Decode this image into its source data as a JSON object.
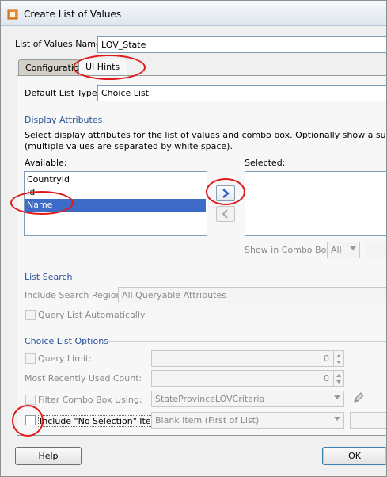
{
  "window": {
    "title": "Create List of Values"
  },
  "lov_name": {
    "label": "List of Values Name:",
    "value": "LOV_State"
  },
  "tabs": [
    {
      "label": "Configuration"
    },
    {
      "label": "UI Hints"
    }
  ],
  "default_list_type": {
    "label": "Default List Type:",
    "value": "Choice List"
  },
  "display_attributes": {
    "title": "Display Attributes",
    "description_line1": "Select display attributes for the list of values and combo box. Optionally show a subset in the",
    "description_line2": "(multiple values are separated by white space).",
    "available_label": "Available:",
    "selected_label": "Selected:",
    "available_items": [
      "CountryId",
      "Id",
      "Name"
    ],
    "show_in_combo_label": "Show in Combo Box:",
    "show_in_combo_value": "All"
  },
  "list_search": {
    "title": "List Search",
    "include_search_region_label": "Include Search Region:",
    "include_search_region_value": "All Queryable Attributes",
    "query_automatically_label": "Query List Automatically"
  },
  "choice_list_options": {
    "title": "Choice List Options",
    "query_limit_label": "Query Limit:",
    "query_limit_value": "0",
    "most_recently_used_label": "Most Recently Used Count:",
    "most_recently_used_value": "0",
    "filter_combo_label": "Filter Combo Box Using:",
    "filter_combo_value": "StateProvinceLOVCriteria",
    "include_no_selection_label": "Include \"No Selection\" Item:",
    "include_no_selection_value": "Blank Item (First of List)"
  },
  "buttons": {
    "help": "Help",
    "ok": "OK"
  },
  "colors": {
    "section_title": "#2a5298",
    "selection": "#3d6bc7",
    "annotation": "#e01a1a"
  }
}
